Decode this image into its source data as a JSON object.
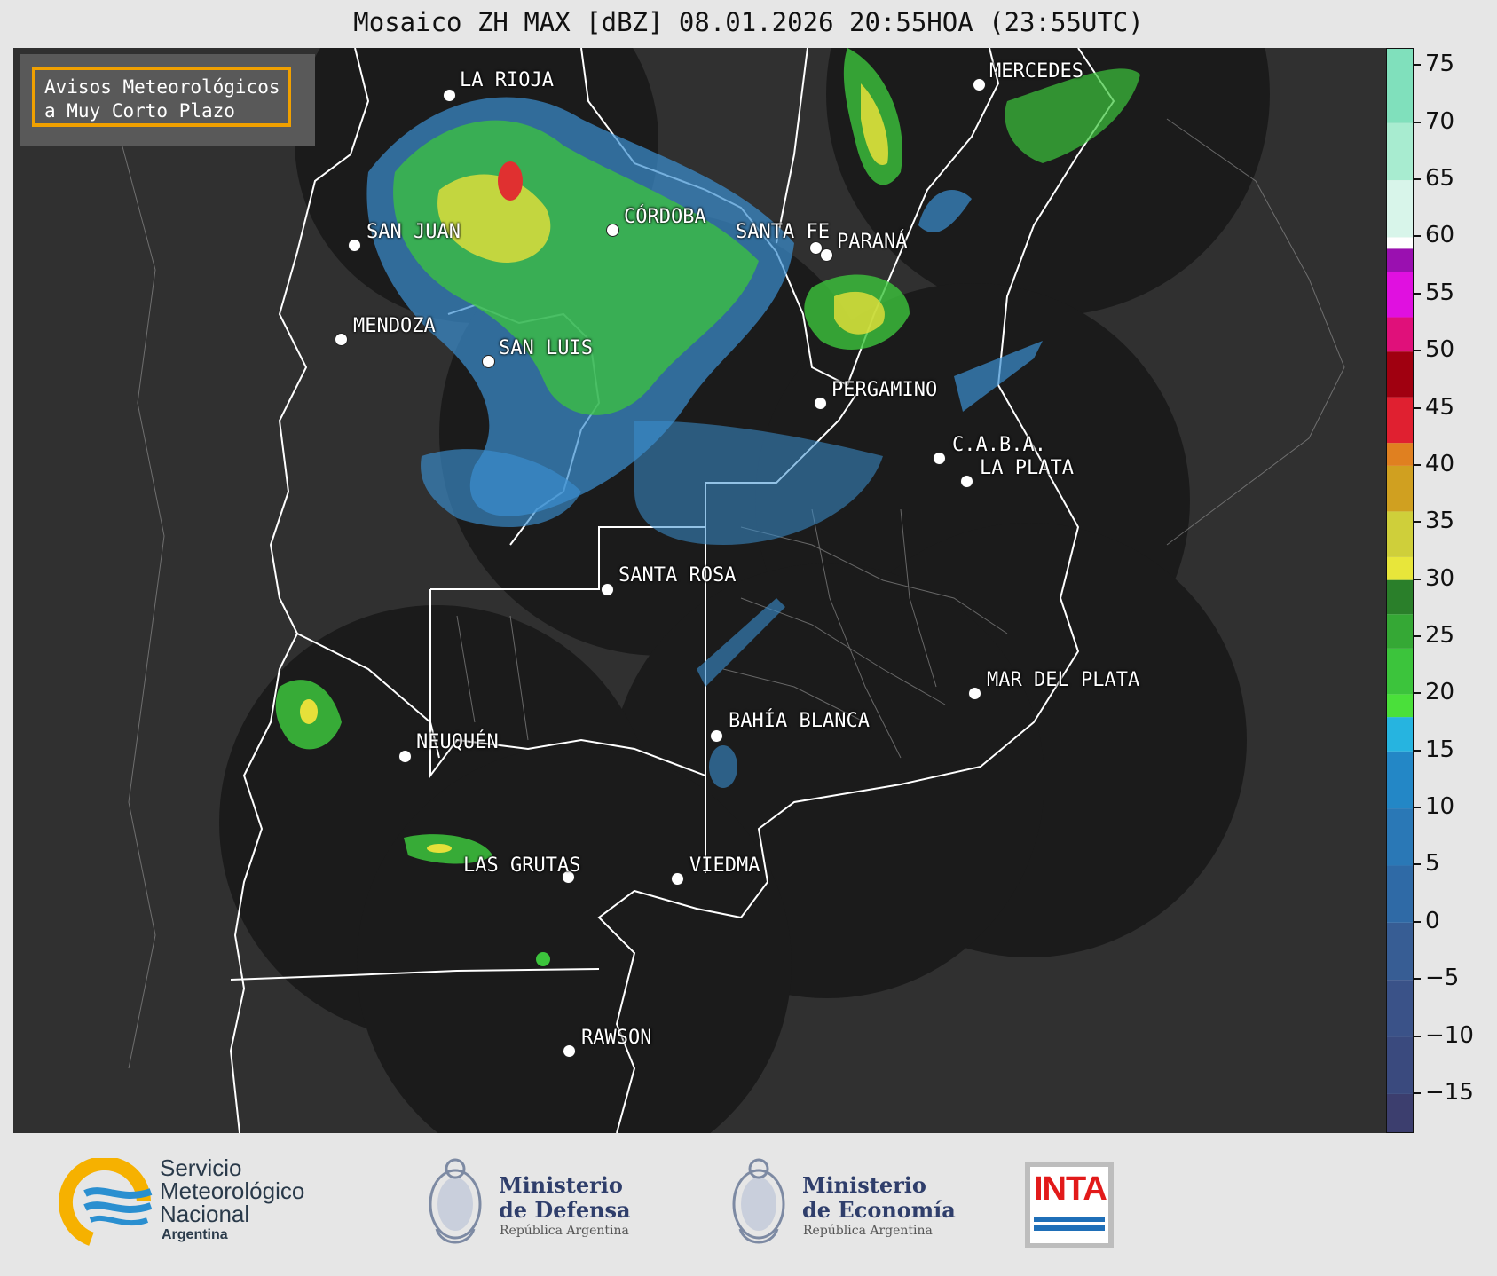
{
  "title": "Mosaico ZH MAX [dBZ] 08.01.2026 20:55HOA (23:55UTC)",
  "notice": {
    "line1": "Avisos Meteorológicos",
    "line2": "a Muy Corto Plazo"
  },
  "cities": [
    {
      "id": "la-rioja",
      "name": "LA RIOJA"
    },
    {
      "id": "mercedes",
      "name": "MERCEDES"
    },
    {
      "id": "cordoba",
      "name": "CÓRDOBA"
    },
    {
      "id": "san-juan",
      "name": "SAN JUAN"
    },
    {
      "id": "santa-fe",
      "name": "SANTA FE"
    },
    {
      "id": "parana",
      "name": "PARANÁ"
    },
    {
      "id": "mendoza",
      "name": "MENDOZA"
    },
    {
      "id": "san-luis",
      "name": "SAN LUIS"
    },
    {
      "id": "pergamino",
      "name": "PERGAMINO"
    },
    {
      "id": "caba",
      "name": "C.A.B.A."
    },
    {
      "id": "la-plata",
      "name": "LA PLATA"
    },
    {
      "id": "santa-rosa",
      "name": "SANTA ROSA"
    },
    {
      "id": "mar-del-plata",
      "name": "MAR DEL PLATA"
    },
    {
      "id": "bahia-blanca",
      "name": "BAHÍA BLANCA"
    },
    {
      "id": "neuquen",
      "name": "NEUQUÉN"
    },
    {
      "id": "las-grutas",
      "name": "LAS GRUTAS"
    },
    {
      "id": "viedma",
      "name": "VIEDMA"
    },
    {
      "id": "rawson",
      "name": "RAWSON"
    }
  ],
  "colorbar": {
    "min": -18.5,
    "max": 76.5,
    "ticks": [
      "75",
      "70",
      "65",
      "60",
      "55",
      "50",
      "45",
      "40",
      "35",
      "30",
      "25",
      "20",
      "15",
      "10",
      "5",
      "0",
      "−5",
      "−10",
      "−15"
    ],
    "tick_values": [
      75,
      70,
      65,
      60,
      55,
      50,
      45,
      40,
      35,
      30,
      25,
      20,
      15,
      10,
      5,
      0,
      -5,
      -10,
      -15
    ]
  },
  "logos": {
    "smn": {
      "line1": "Servicio",
      "line2": "Meteorológico",
      "line3": "Nacional",
      "line4": "Argentina"
    },
    "defensa": {
      "line1": "Ministerio",
      "line2": "de Defensa",
      "sub": "República Argentina"
    },
    "economia": {
      "line1": "Ministerio",
      "line2": "de Economía",
      "sub": "República Argentina"
    },
    "inta": {
      "text": "INTA"
    }
  },
  "colors": {
    "radar_coverage": "#1b1b1b",
    "map_background": "#303030",
    "notice_border": "#f0a000",
    "echo_low": "#3a8fd0",
    "echo_mid": "#3cc43c",
    "echo_high": "#e6e03a",
    "echo_max": "#e03030"
  }
}
